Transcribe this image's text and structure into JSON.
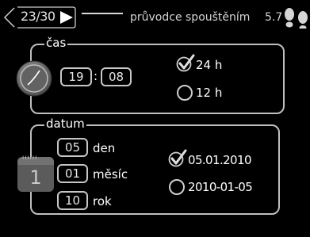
{
  "header": {
    "page_indicator": "23/30",
    "title": "průvodce spouštěním",
    "version": "5.7"
  },
  "time": {
    "label": "čas",
    "hours": "19",
    "separator": ":",
    "minutes": "08",
    "formats": [
      {
        "label": "24 h",
        "selected": true
      },
      {
        "label": "12 h",
        "selected": false
      }
    ]
  },
  "date": {
    "label": "datum",
    "day_value": "05",
    "day_label": "den",
    "month_value": "01",
    "month_label": "měsíc",
    "year_value": "10",
    "year_label": "rok",
    "calendar_number": "1",
    "formats": [
      {
        "label": "05.01.2010",
        "selected": true
      },
      {
        "label": "2010-01-05",
        "selected": false
      }
    ]
  }
}
